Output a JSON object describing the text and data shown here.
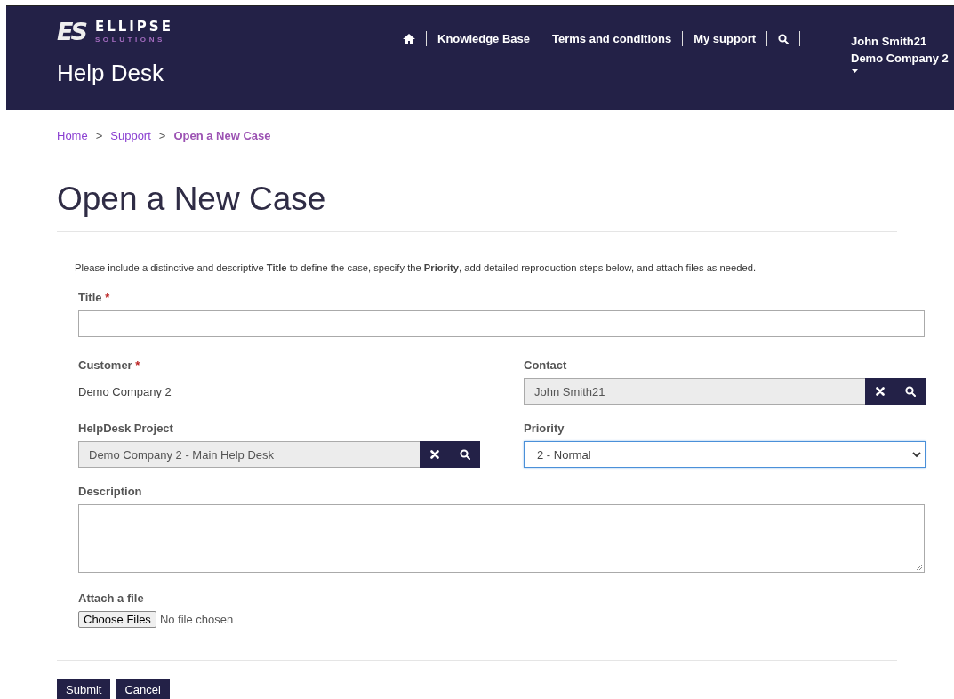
{
  "header": {
    "logo": {
      "mark": "ES",
      "name": "ELLIPSE",
      "tagline": "SOLUTIONS"
    },
    "title": "Help Desk",
    "nav": [
      {
        "kind": "home"
      },
      {
        "kind": "link",
        "label": "Knowledge Base"
      },
      {
        "kind": "link",
        "label": "Terms and conditions"
      },
      {
        "kind": "link",
        "label": "My support"
      },
      {
        "kind": "search"
      }
    ],
    "user": {
      "name": "John Smith21",
      "company": "Demo Company 2"
    }
  },
  "breadcrumb": [
    {
      "label": "Home",
      "current": false
    },
    {
      "label": "Support",
      "current": false
    },
    {
      "label": "Open a New Case",
      "current": true
    }
  ],
  "breadcrumb_separator": ">",
  "page_title": "Open a New Case",
  "instructions": "Please include a distinctive and descriptive **Title** to define the case, specify the **Priority**, add detailed reproduction steps below, and attach files as needed.",
  "fields": [
    {
      "kind": "text",
      "label": "Title",
      "required_mark": "*"
    },
    {
      "kind": "static",
      "label": "Customer",
      "required_mark": "*",
      "value": "Demo Company 2"
    },
    {
      "kind": "lookup",
      "label": "Contact",
      "value": "John Smith21"
    },
    {
      "kind": "lookup",
      "label": "HelpDesk Project",
      "value": "Demo Company 2 - Main Help Desk"
    },
    {
      "kind": "select",
      "label": "Priority",
      "value": "2 - Normal",
      "focused": true
    },
    {
      "kind": "textarea",
      "label": "Description"
    },
    {
      "kind": "file",
      "label": "Attach a file",
      "button": "Choose Files",
      "status": "No file chosen"
    }
  ],
  "buttons": [
    "Submit",
    "Cancel"
  ]
}
